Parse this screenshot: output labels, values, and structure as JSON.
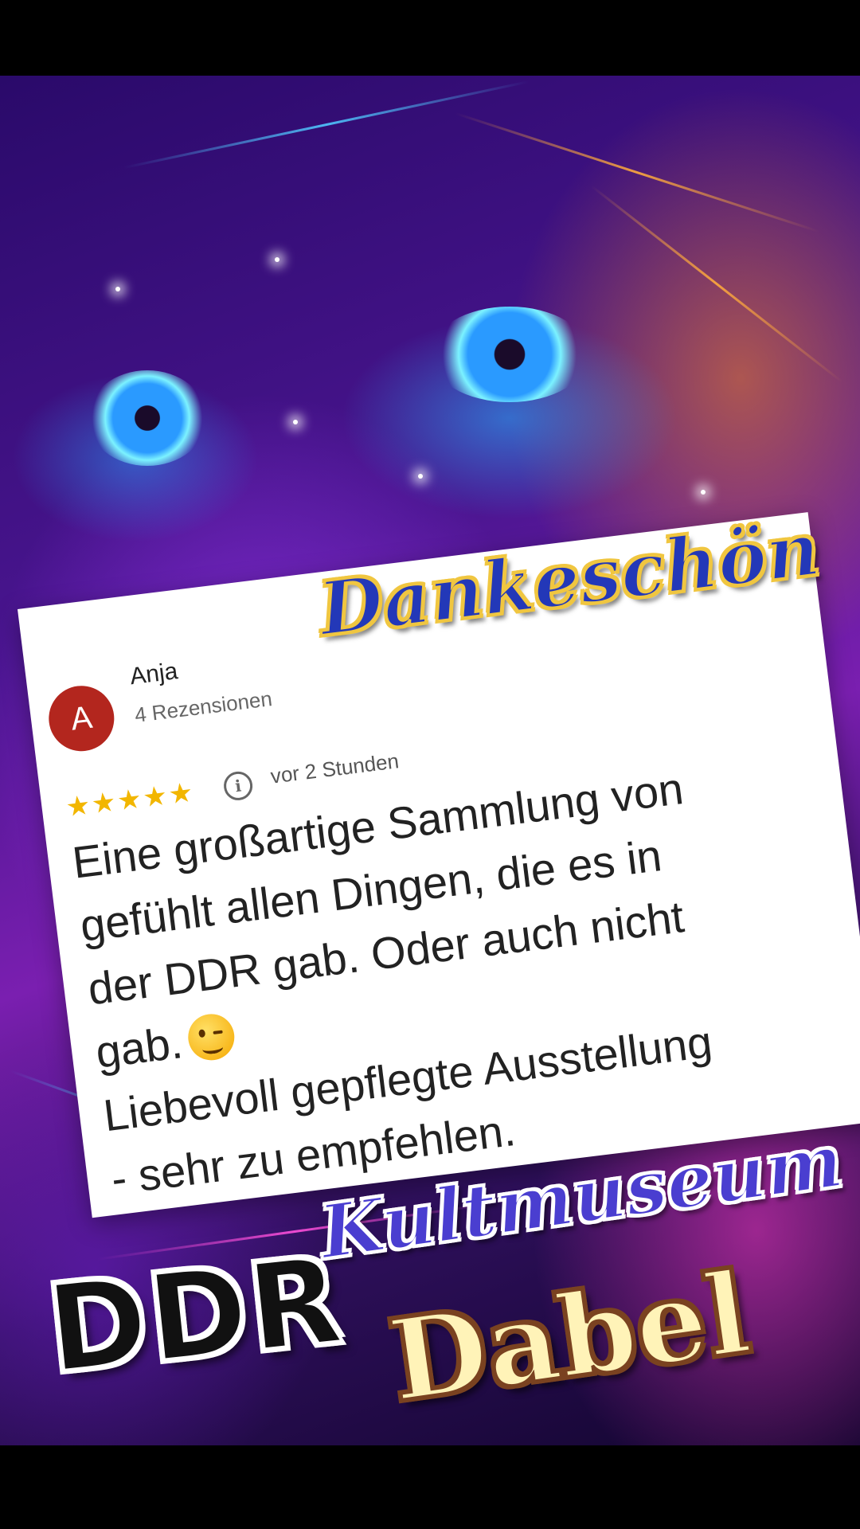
{
  "review": {
    "avatar_letter": "A",
    "author": "Anja",
    "review_count": "4 Rezensionen",
    "rating": 5,
    "rating_max": 5,
    "stars": "★★★★★",
    "info_glyph": "i",
    "time": "vor 2 Stunden",
    "text_lines": [
      "Eine großartige Sammlung von",
      "gefühlt allen Dingen, die es in",
      "der DDR gab. Oder auch nicht",
      "gab.",
      "Liebevoll gepflegte Ausstellung",
      "- sehr zu empfehlen."
    ],
    "emoji_name": "winking-face-icon"
  },
  "overlay": {
    "danke": "Dankeschön",
    "ddr": "DDR",
    "kultmuseum": "Kultmuseum",
    "dabel": "Dabel"
  },
  "colors": {
    "avatar": "#b3261e",
    "stars": "#f2b600",
    "danke_fill": "#2338b8",
    "danke_outline": "#f0c640",
    "kult_fill": "#4a3ed0",
    "dabel_fill": "#fff3b8",
    "dabel_outline": "#7a4220"
  }
}
